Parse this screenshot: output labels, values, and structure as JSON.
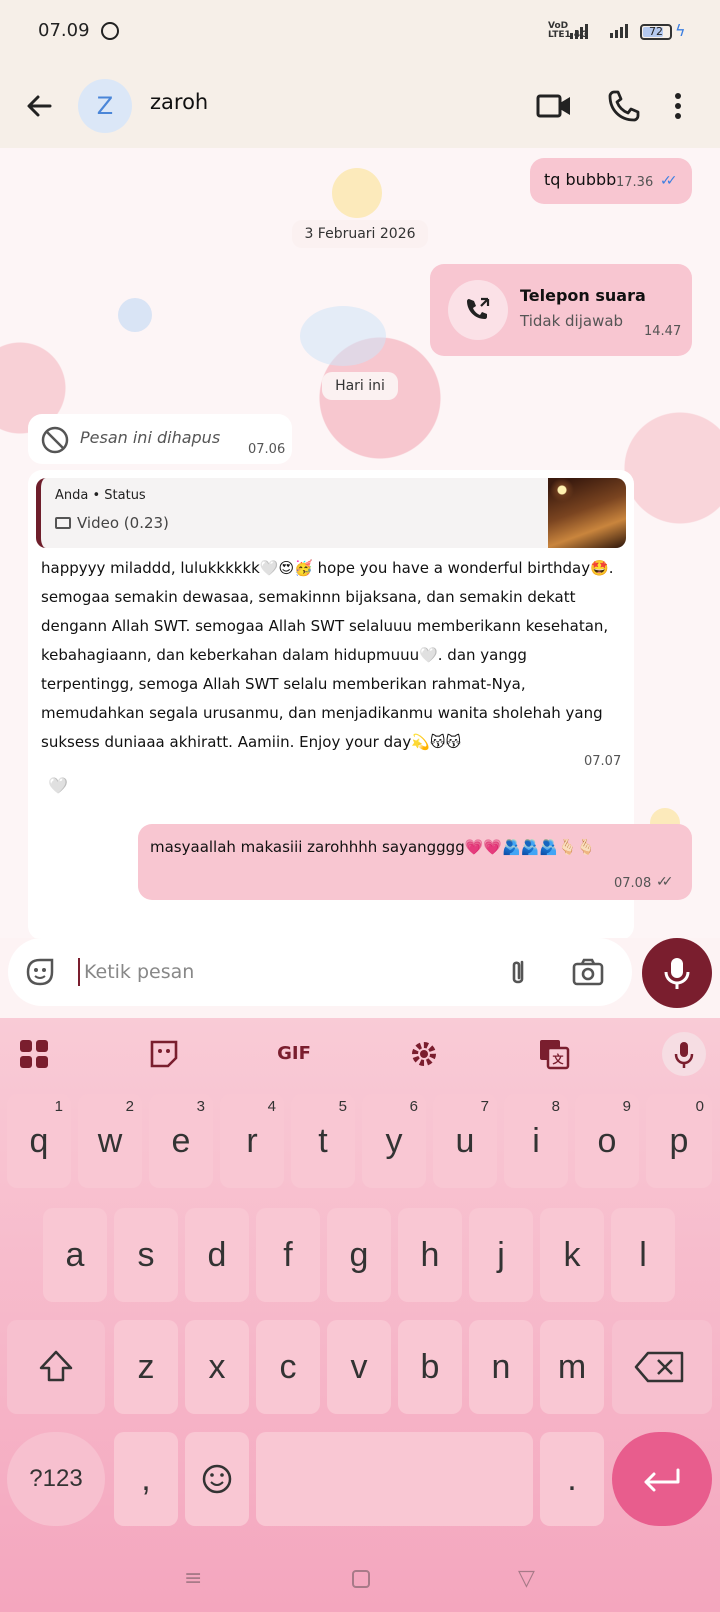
{
  "status_bar": {
    "time": "07.09",
    "network_label": "VoD LTE1 4G",
    "battery_level": "72"
  },
  "header": {
    "avatar_letter": "Z",
    "contact_name": "zaroh"
  },
  "messages": {
    "m1": {
      "text": "tq bubbb",
      "time": "17.36"
    },
    "date_chip_1": "3 Februari 2026",
    "call": {
      "title": "Telepon suara",
      "subtitle": "Tidak dijawab",
      "time": "14.47"
    },
    "date_chip_2": "Hari ini",
    "deleted": {
      "text": "Pesan ini dihapus",
      "time": "07.06"
    },
    "reply": {
      "who": "Anda • Status",
      "media": "Video (0.23)",
      "body": "happyyy miladdd, lulukkkkkk🤍😍🥳 hope you have a wonderful birthday🤩. semogaa semakin dewasaa, semakinnn bijaksana, dan semakin dekatt dengann Allah SWT. semogaa Allah SWT selaluuu memberikann kesehatan, kebahagiaann, dan keberkahan dalam hidupmuuu🤍. dan yangg terpentingg, semoga Allah SWT selalu memberikan rahmat-Nya, memudahkan segala urusanmu, dan menjadikanmu wanita sholehah yang suksess duniaaa akhiratt. Aamiin. Enjoy your day💫😽😽",
      "time": "07.07",
      "reaction": "🤍"
    },
    "m_last": {
      "text": "masyaallah makasiii zarohhhh sayangggg💗💗🫂🫂🫂🫰🏻🫰🏻",
      "time": "07.08"
    }
  },
  "composer": {
    "placeholder": "Ketik pesan"
  },
  "keyboard": {
    "toolbar": [
      "GIF"
    ],
    "row1": [
      {
        "k": "q",
        "h": "1"
      },
      {
        "k": "w",
        "h": "2"
      },
      {
        "k": "e",
        "h": "3"
      },
      {
        "k": "r",
        "h": "4"
      },
      {
        "k": "t",
        "h": "5"
      },
      {
        "k": "y",
        "h": "6"
      },
      {
        "k": "u",
        "h": "7"
      },
      {
        "k": "i",
        "h": "8"
      },
      {
        "k": "o",
        "h": "9"
      },
      {
        "k": "p",
        "h": "0"
      }
    ],
    "row2": [
      "a",
      "s",
      "d",
      "f",
      "g",
      "h",
      "j",
      "k",
      "l"
    ],
    "row3": [
      "z",
      "x",
      "c",
      "v",
      "b",
      "n",
      "m"
    ],
    "symbols": "?123",
    "comma": ",",
    "period": "."
  },
  "colors": {
    "accent": "#7a1e2e",
    "outgoing_bubble": "#f8c6d1",
    "ticks_read": "#3d7fe0",
    "enter_key": "#e85d8d"
  }
}
